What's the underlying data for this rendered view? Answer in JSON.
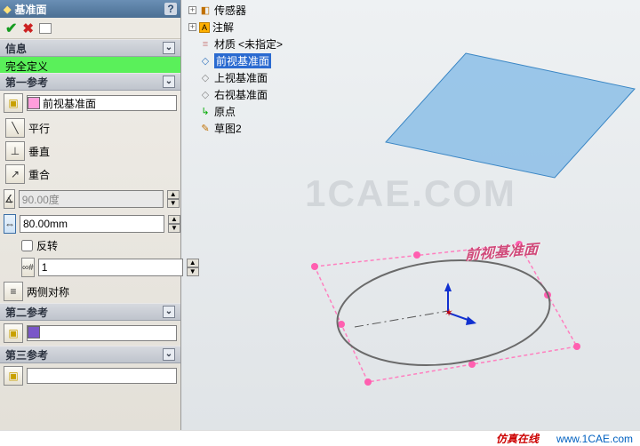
{
  "panel": {
    "title": "基准面",
    "help": "?",
    "info_head": "信息",
    "status": "完全定义",
    "ref1_head": "第一参考",
    "ref1_value": "前视基准面",
    "opts": {
      "parallel": "平行",
      "perp": "垂直",
      "coincident": "重合"
    },
    "angle_value": "90.00度",
    "dist_value": "80.00mm",
    "flip_label": "反转",
    "instances_value": "1",
    "sym_label": "两侧对称",
    "ref2_head": "第二参考",
    "ref3_head": "第三参考"
  },
  "tree": {
    "n0": "传感器",
    "n1": "注解",
    "n2a": "材质",
    "n2b": "<未指定>",
    "n3": "前视基准面",
    "n4": "上视基准面",
    "n5": "右视基准面",
    "n6": "原点",
    "n7": "草图2"
  },
  "scene": {
    "sketch_label": "前视基准面"
  },
  "footer": {
    "brand": "仿真在线",
    "url": "www.1CAE.com"
  },
  "watermark": "1CAE.COM"
}
